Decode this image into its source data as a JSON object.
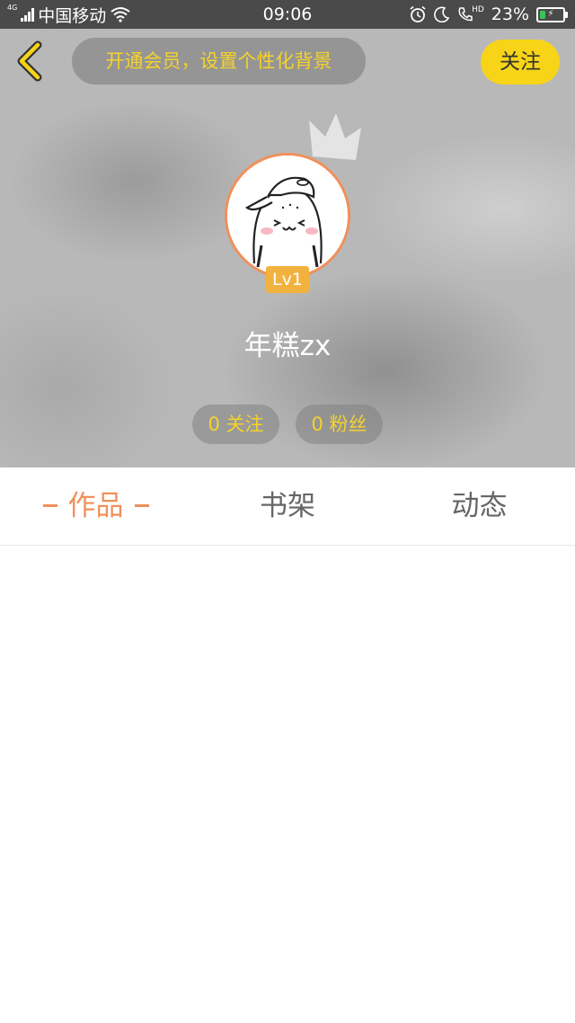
{
  "status_bar": {
    "network_tag": "4G",
    "carrier": "中国移动",
    "time": "09:06",
    "hd_label": "HD",
    "battery_percent": "23%",
    "battery_level": 0.23,
    "icons": [
      "signal-icon",
      "wifi-icon",
      "alarm-icon",
      "moon-icon",
      "hd-call-icon",
      "battery-icon"
    ]
  },
  "header": {
    "back_icon": "chevron-left-icon",
    "vip_banner": "开通会员，设置个性化背景",
    "follow_button": "关注",
    "level": "Lv1",
    "username": "年糕zx",
    "stats": {
      "following": "0 关注",
      "fans": "0 粉丝"
    }
  },
  "tabs": [
    {
      "label": "作品",
      "active": true
    },
    {
      "label": "书架",
      "active": false
    },
    {
      "label": "动态",
      "active": false
    }
  ],
  "colors": {
    "accent_orange": "#f0905a",
    "accent_yellow": "#f5d22b",
    "follow_yellow": "#f7d417",
    "status_bar_bg": "#4a4a4a"
  }
}
